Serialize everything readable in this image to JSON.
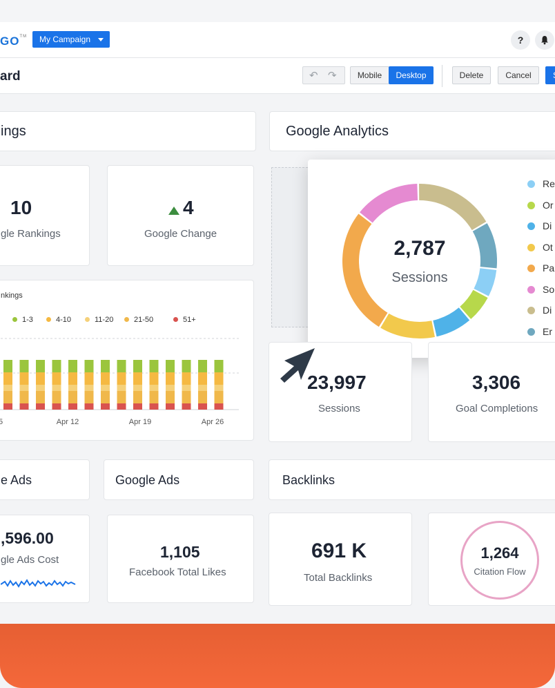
{
  "header": {
    "logo": "GO",
    "logo_tm": "TM",
    "campaign_label": "My Campaign",
    "help_icon": "question-icon",
    "notifications_icon": "bell-icon"
  },
  "toolbar": {
    "title": "ard",
    "undo_icon": "undo-icon",
    "redo_icon": "redo-icon",
    "mobile_label": "Mobile",
    "desktop_label": "Desktop",
    "delete_label": "Delete",
    "cancel_label": "Cancel",
    "save_label": "S"
  },
  "rankings": {
    "section_title": "ings",
    "rankings_value": "10",
    "rankings_label": "gle Rankings",
    "change_value": "4",
    "change_label": "Google Change",
    "chart_title": "nkings",
    "legend": [
      "1-3",
      "4-10",
      "11-20",
      "21-50",
      "51+"
    ],
    "x_ticks": [
      "5",
      "Apr 12",
      "Apr 19",
      "Apr 26"
    ]
  },
  "analytics": {
    "section_title": "Google Analytics",
    "donut_value": "2,787",
    "donut_label": "Sessions",
    "legend": [
      "Re",
      "Or",
      "Di",
      "Ot",
      "Pa",
      "So",
      "Di",
      "Er"
    ],
    "sessions_value": "23,997",
    "sessions_label": "Sessions",
    "goals_value": "3,306",
    "goals_label": "Goal Completions"
  },
  "ads": {
    "section_title_left": "e Ads",
    "section_title": "Google Ads",
    "cost_value": ",596.00",
    "cost_label": "gle Ads Cost",
    "likes_value": "1,105",
    "likes_label": "Facebook Total Likes"
  },
  "backlinks": {
    "section_title": "Backlinks",
    "total_value": "691 K",
    "total_label": "Total Backlinks",
    "flow_value": "1,264",
    "flow_label": "Citation Flow"
  },
  "colors": {
    "accent": "#1a73e8",
    "footer": "#f4683a",
    "rank_1_3": "#9bc53d",
    "rank_4_10": "#f5b942",
    "rank_11_20": "#f5d17a",
    "rank_21_50": "#f0b84b",
    "rank_51": "#d9534f"
  },
  "chart_data": [
    {
      "type": "bar",
      "title": "",
      "stacked": true,
      "categories_note": "daily bars, Apr",
      "x_tick_labels": [
        "5",
        "Apr 12",
        "Apr 19",
        "Apr 26"
      ],
      "series": [
        {
          "name": "1-3",
          "values": [
            2,
            2,
            2,
            2,
            2,
            2,
            2,
            2,
            2,
            2,
            2,
            2,
            2,
            2
          ]
        },
        {
          "name": "4-10",
          "values": [
            2,
            2,
            2,
            2,
            2,
            2,
            2,
            2,
            2,
            2,
            2,
            2,
            2,
            2
          ]
        },
        {
          "name": "11-20",
          "values": [
            1,
            1,
            1,
            1,
            1,
            1,
            1,
            1,
            1,
            1,
            1,
            1,
            1,
            1
          ]
        },
        {
          "name": "21-50",
          "values": [
            2,
            2,
            2,
            2,
            2,
            2,
            2,
            2,
            2,
            2,
            2,
            2,
            2,
            2
          ]
        },
        {
          "name": "51+",
          "values": [
            1,
            1,
            1,
            1,
            1,
            1,
            1,
            1,
            1,
            1,
            1,
            1,
            1,
            1
          ]
        }
      ]
    },
    {
      "type": "pie",
      "donut": true,
      "center_value": "2,787",
      "center_label": "Sessions",
      "labels": [
        "Re",
        "Or",
        "Di",
        "Ot",
        "Pa",
        "So",
        "Di",
        "Er"
      ],
      "values": [
        12,
        27,
        14,
        17,
        10,
        6,
        6,
        8
      ],
      "colors": [
        "#f2c94c",
        "#f2a94c",
        "#e58ad1",
        "#c9bd8e",
        "#6fa8bf",
        "#8ccff5",
        "#b7d84b",
        "#4fb2e8"
      ]
    }
  ]
}
